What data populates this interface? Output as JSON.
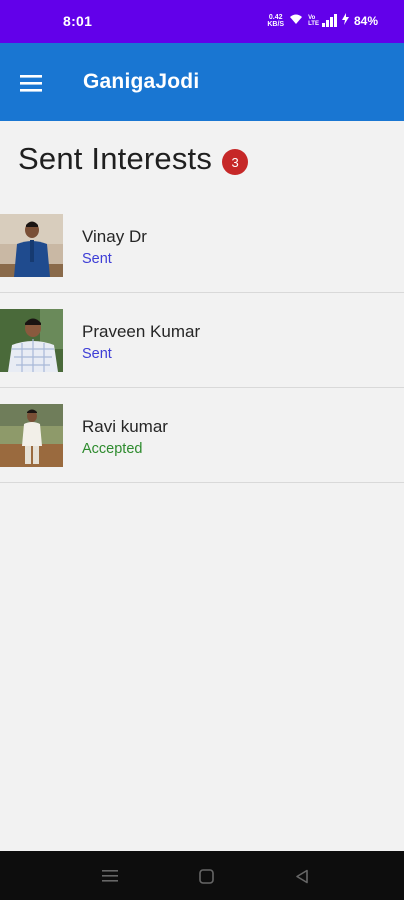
{
  "status_bar": {
    "time": "8:01",
    "net_speed_value": "0.42",
    "net_speed_unit": "KB/S",
    "battery_percent": "84%",
    "network_badge_top": "Vo",
    "network_badge_bottom": "LTE"
  },
  "app_bar": {
    "title": "GanigaJodi"
  },
  "page": {
    "title": "Sent Interests",
    "count": "3"
  },
  "interests": [
    {
      "name": "Vinay Dr",
      "status": "Sent",
      "status_color": "#3d3dd6"
    },
    {
      "name": "Praveen Kumar",
      "status": "Sent",
      "status_color": "#3d3dd6"
    },
    {
      "name": "Ravi kumar",
      "status": "Accepted",
      "status_color": "#2e8b2e"
    }
  ],
  "colors": {
    "status_bar": "#6200ea",
    "app_bar": "#1976d2",
    "badge": "#c62828",
    "background": "#f2f2f2"
  }
}
